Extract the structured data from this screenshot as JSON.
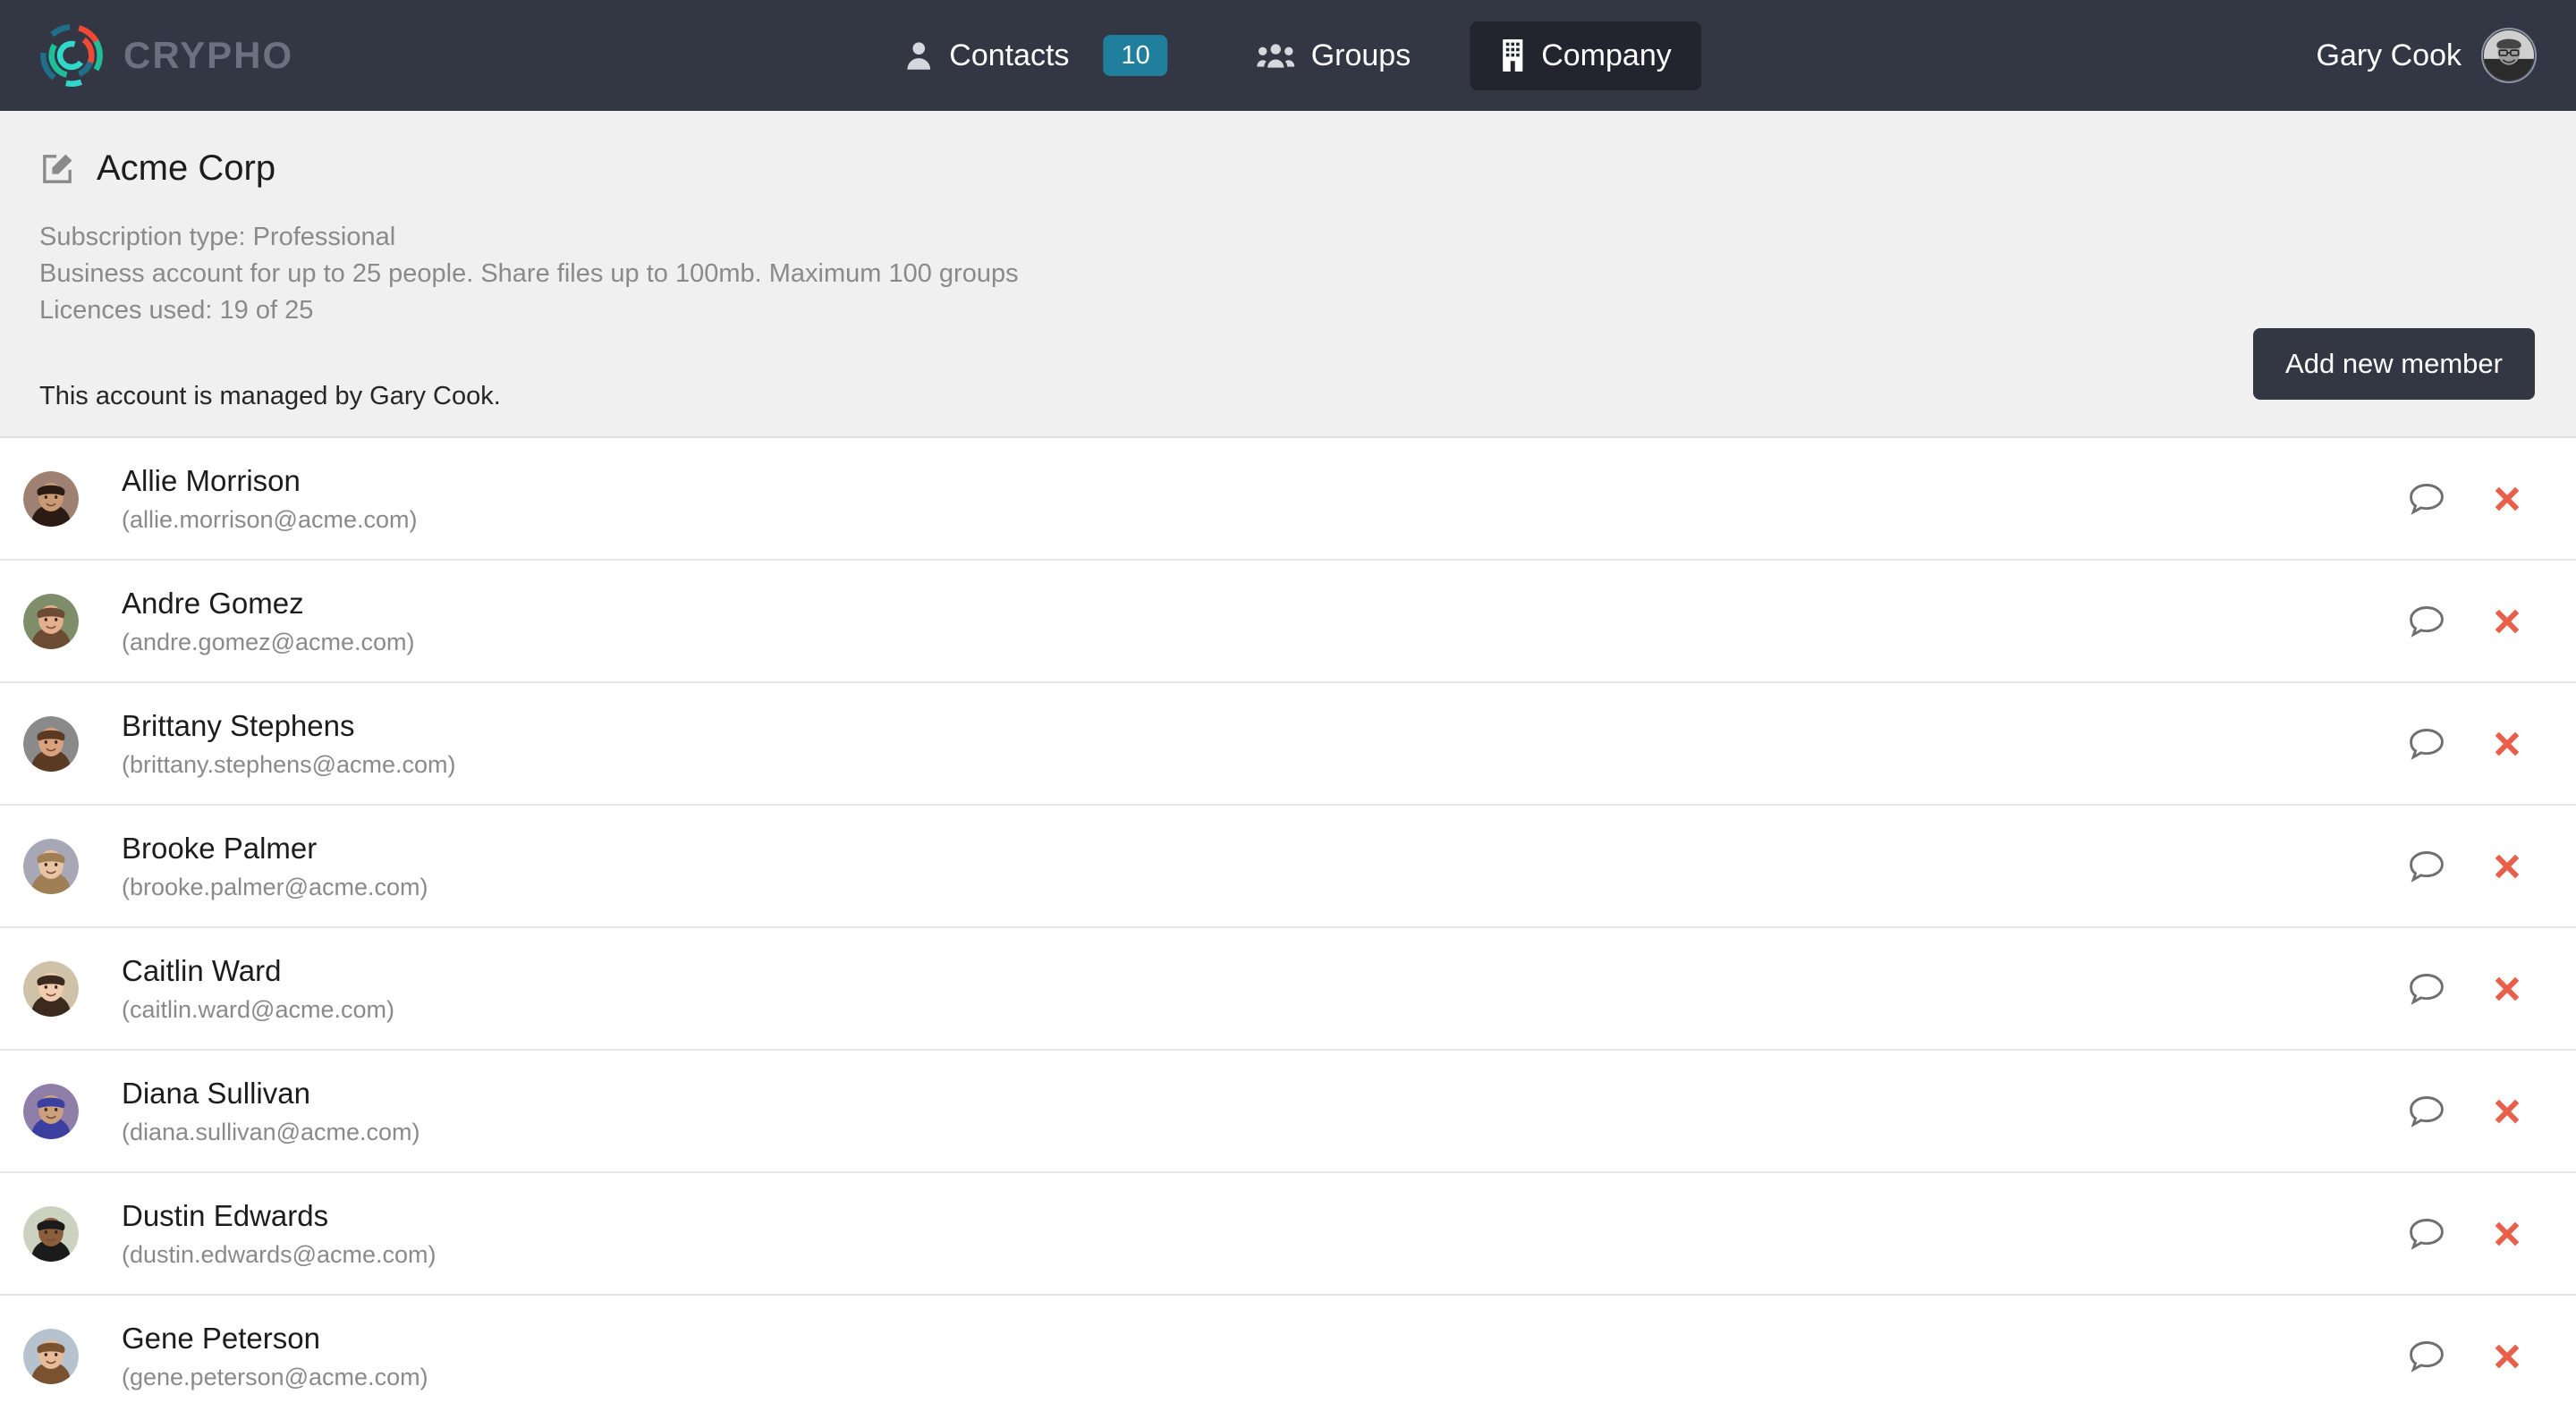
{
  "brand": {
    "name": "CRYPHO",
    "logo_icon": "crypho-ring-logo"
  },
  "nav": {
    "items": [
      {
        "label": "Contacts",
        "icon": "user-icon",
        "badge": "10",
        "active": false
      },
      {
        "label": "Groups",
        "icon": "users-icon",
        "badge": null,
        "active": false
      },
      {
        "label": "Company",
        "icon": "building-icon",
        "badge": null,
        "active": true
      }
    ],
    "user": {
      "name": "Gary Cook",
      "avatar_icon": "user-avatar"
    },
    "badge_color": "#1f7f9c",
    "bar_color": "#333744",
    "active_tab_color": "#22252e"
  },
  "company": {
    "title": "Acme Corp",
    "edit_icon": "edit-pencil-icon",
    "subscription_line": "Subscription type: Professional",
    "description_line": "Business account for up to 25 people. Share files up to 100mb. Maximum 100 groups",
    "licences_line": "Licences used: 19 of 25",
    "managed_by_line": "This account is managed by Gary Cook.",
    "add_member_label": "Add new member"
  },
  "members": [
    {
      "name": "Allie Morrison",
      "email": "(allie.morrison@acme.com)"
    },
    {
      "name": "Andre Gomez",
      "email": "(andre.gomez@acme.com)"
    },
    {
      "name": "Brittany Stephens",
      "email": "(brittany.stephens@acme.com)"
    },
    {
      "name": "Brooke Palmer",
      "email": "(brooke.palmer@acme.com)"
    },
    {
      "name": "Caitlin Ward",
      "email": "(caitlin.ward@acme.com)"
    },
    {
      "name": "Diana Sullivan",
      "email": "(diana.sullivan@acme.com)"
    },
    {
      "name": "Dustin Edwards",
      "email": "(dustin.edwards@acme.com)"
    },
    {
      "name": "Gene Peterson",
      "email": "(gene.peterson@acme.com)"
    }
  ],
  "row_actions": {
    "chat_icon": "chat-bubble-icon",
    "remove_icon": "remove-x-icon",
    "remove_color": "#e8604c"
  }
}
